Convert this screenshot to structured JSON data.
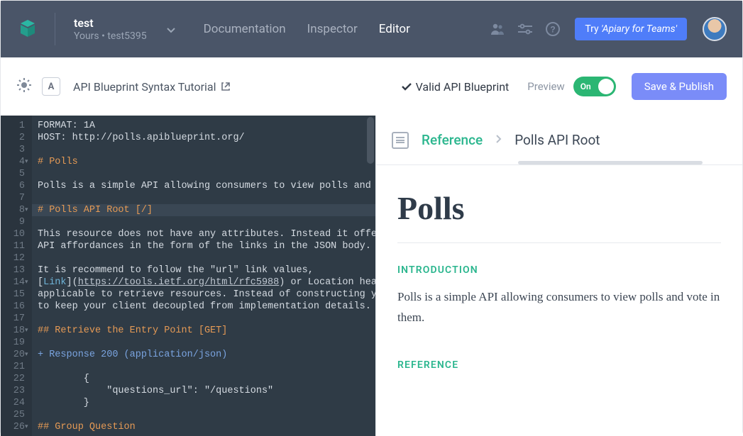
{
  "header": {
    "project_title": "test",
    "project_sub_prefix": "Yours • ",
    "project_sub_name": "test5395",
    "nav": {
      "documentation": "Documentation",
      "inspector": "Inspector",
      "editor": "Editor"
    },
    "try_button_prefix": "Try ",
    "try_button_em": "'Apiary for Teams'"
  },
  "toolbar": {
    "a_badge": "A",
    "syntax_link": "API Blueprint Syntax Tutorial",
    "valid_label": "Valid API Blueprint",
    "preview_label": "Preview",
    "toggle_label": "On",
    "publish_label": "Save & Publish"
  },
  "editor": {
    "lines": [
      {
        "n": 1,
        "cls": "",
        "parts": [
          {
            "t": "FORMAT: 1A"
          }
        ]
      },
      {
        "n": 2,
        "cls": "",
        "parts": [
          {
            "t": "HOST: http://polls.apiblueprint.org/"
          }
        ]
      },
      {
        "n": 3,
        "cls": "",
        "parts": []
      },
      {
        "n": 4,
        "cls": "fold",
        "parts": [
          {
            "t": "# Polls",
            "c": "c-orange"
          }
        ]
      },
      {
        "n": 5,
        "cls": "",
        "parts": []
      },
      {
        "n": 6,
        "cls": "",
        "parts": [
          {
            "t": "Polls is a simple API allowing consumers to view polls and "
          }
        ]
      },
      {
        "n": 7,
        "cls": "",
        "parts": []
      },
      {
        "n": 8,
        "cls": "sel fold",
        "parts": [
          {
            "t": "# Polls API Root [/]",
            "c": "c-orange"
          }
        ]
      },
      {
        "n": 9,
        "cls": "",
        "parts": []
      },
      {
        "n": 10,
        "cls": "",
        "parts": [
          {
            "t": "This resource does not have any attributes. Instead it offe"
          }
        ]
      },
      {
        "n": 11,
        "cls": "",
        "parts": [
          {
            "t": "API affordances in the form of the links in the JSON body."
          }
        ]
      },
      {
        "n": 12,
        "cls": "",
        "parts": []
      },
      {
        "n": 13,
        "cls": "",
        "parts": [
          {
            "t": "It is recommend to follow the \"url\" link values,"
          }
        ]
      },
      {
        "n": 14,
        "cls": "fold",
        "parts": [
          {
            "t": "["
          },
          {
            "t": "Link",
            "c": "c-link"
          },
          {
            "t": "]("
          },
          {
            "t": "https://tools.ietf.org/html/rfc5988",
            "c": "c-url"
          },
          {
            "t": ") or Location hea"
          }
        ]
      },
      {
        "n": 15,
        "cls": "",
        "parts": [
          {
            "t": "applicable to retrieve resources. Instead of constructing y"
          }
        ]
      },
      {
        "n": 16,
        "cls": "",
        "parts": [
          {
            "t": "to keep your client decoupled from implementation details."
          }
        ]
      },
      {
        "n": 17,
        "cls": "",
        "parts": []
      },
      {
        "n": 18,
        "cls": "fold",
        "parts": [
          {
            "t": "## Retrieve the Entry Point [GET]",
            "c": "c-orange"
          }
        ]
      },
      {
        "n": 19,
        "cls": "",
        "parts": []
      },
      {
        "n": 20,
        "cls": "fold",
        "parts": [
          {
            "t": "+ Response 200 (application/json)",
            "c": "c-blue"
          }
        ]
      },
      {
        "n": 21,
        "cls": "",
        "parts": []
      },
      {
        "n": 22,
        "cls": "",
        "parts": [
          {
            "t": "        {"
          }
        ]
      },
      {
        "n": 23,
        "cls": "",
        "parts": [
          {
            "t": "            \"questions_url\": \"/questions\""
          }
        ]
      },
      {
        "n": 24,
        "cls": "",
        "parts": [
          {
            "t": "        }"
          }
        ]
      },
      {
        "n": 25,
        "cls": "",
        "parts": []
      },
      {
        "n": 26,
        "cls": "fold",
        "parts": [
          {
            "t": "## Group Question",
            "c": "c-orange"
          }
        ]
      }
    ]
  },
  "breadcrumb": {
    "reference": "Reference",
    "title": "Polls API Root"
  },
  "doc": {
    "h1": "Polls",
    "intro_label": "INTRODUCTION",
    "intro_text": "Polls is a simple API allowing consumers to view polls and vote in them.",
    "ref_label": "REFERENCE"
  }
}
